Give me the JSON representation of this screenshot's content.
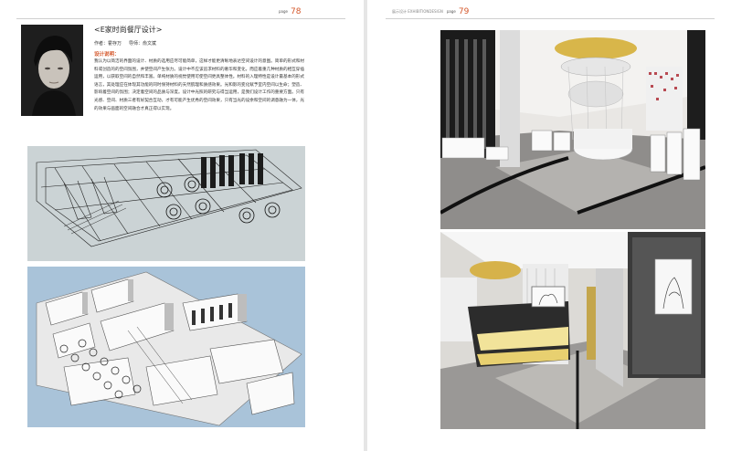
{
  "left_page": {
    "page_label": "page",
    "page_number": "78",
    "title": "<E家时尚餐厅设计>",
    "author_label": "作者：霍存万",
    "advisor_label": "导师：俞文斌",
    "description_label": "设计说明：",
    "description": "我认为以简洁的界面的设计、材质的选用应尽可能简单，这样才能更清晰地表达空间设计的意图。简单的形式和材料或创造的的空间氛围，并使空间产生张力。设计中不应该追求材料的奢华和变化，而应着重几种材质的相互穿插运用，以获取空间的自然和丰富。单纯材质的视觉使用可使空间更具整体性。材料的入理特性是设计最基本的形式语言，其处理应在体现其功能的同时保持材料的天然肌理和质感效果。光和影的变化赋予室内空间以生命；塑造、影响着空间的氛围；决定着空间的品质与深度。设计中光照的研究与得当运用，是我们设计工作的重要方面。只有光感、空间、材质三者有好契合互动，才有可能产生优秀的空间效果，只有当光的设余和空间的调意融为一体，光的效果与画面的空间融合才真正得以实现。"
  },
  "right_page": {
    "page_label": "page",
    "section_label": "展示设计 EXHIBITIONDESIGN",
    "page_number": "79"
  },
  "colors": {
    "accent": "#d4572a",
    "wireframe_bg": "#c9d2d4",
    "model_bg": "#adc6db"
  }
}
